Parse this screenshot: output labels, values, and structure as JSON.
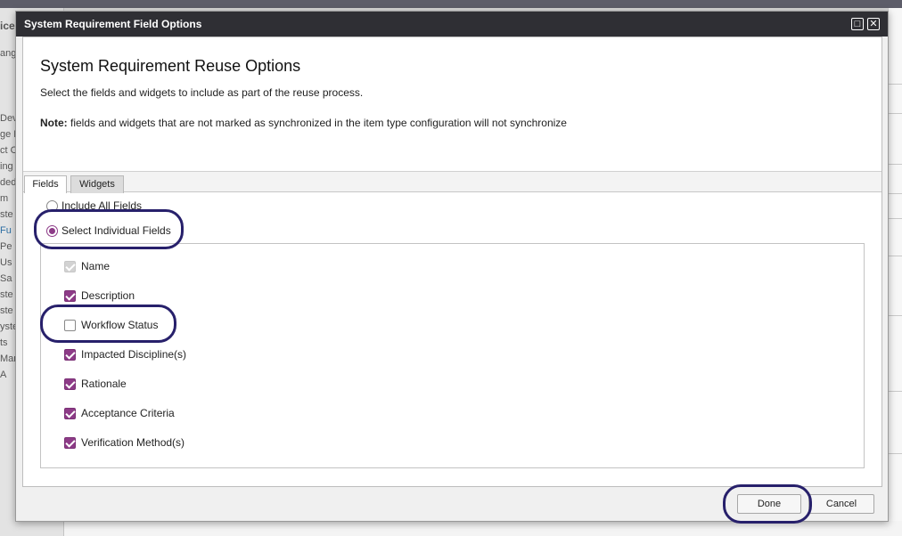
{
  "background": {
    "left_items": [
      "ice",
      "ang",
      "Dev",
      "ge F",
      "ct O",
      "ing",
      "ded",
      "m",
      "ste",
      "Fu",
      "Pe",
      "Us",
      "Sa",
      "ste",
      "ste",
      "yste",
      "ts",
      "Man",
      "A"
    ]
  },
  "dialog": {
    "title": "System Requirement Field Options",
    "maximize_glyph": "□",
    "close_glyph": "✕",
    "heading": "System Requirement Reuse Options",
    "subtext": "Select the fields and widgets to include as part of the reuse process.",
    "note_label": "Note:",
    "note_text": " fields and widgets that are not marked as synchronized in the item type configuration will not synchronize",
    "tabs": [
      {
        "label": "Fields",
        "active": true
      },
      {
        "label": "Widgets",
        "active": false
      }
    ],
    "radios": [
      {
        "label": "Include All Fields",
        "selected": false
      },
      {
        "label": "Select Individual Fields",
        "selected": true
      }
    ],
    "fields": [
      {
        "label": "Name",
        "checked": true,
        "disabled": true
      },
      {
        "label": "Description",
        "checked": true,
        "disabled": false
      },
      {
        "label": "Workflow Status",
        "checked": false,
        "disabled": false
      },
      {
        "label": "Impacted Discipline(s)",
        "checked": true,
        "disabled": false
      },
      {
        "label": "Rationale",
        "checked": true,
        "disabled": false
      },
      {
        "label": "Acceptance Criteria",
        "checked": true,
        "disabled": false
      },
      {
        "label": "Verification Method(s)",
        "checked": true,
        "disabled": false
      }
    ],
    "buttons": {
      "done": "Done",
      "cancel": "Cancel"
    }
  },
  "colors": {
    "accent": "#8d3b87",
    "titlebar": "#2f2f34",
    "annotation": "#27206b"
  }
}
